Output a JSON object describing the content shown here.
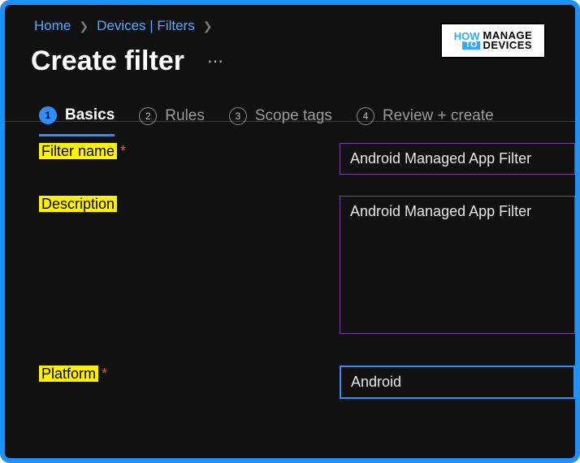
{
  "watermark": {
    "how": "HOW",
    "to": "TO",
    "line1": "MANAGE",
    "line2": "DEVICES"
  },
  "breadcrumb": {
    "home": "Home",
    "devices": "Devices | Filters"
  },
  "page": {
    "title": "Create filter"
  },
  "wizard": {
    "step1": "Basics",
    "step2": "Rules",
    "step3": "Scope tags",
    "step4": "Review + create"
  },
  "form": {
    "filter_name_label": "Filter name",
    "filter_name_value": "Android Managed App Filter",
    "description_label": "Description",
    "description_value": "Android Managed App Filter",
    "platform_label": "Platform",
    "platform_value": "Android"
  }
}
